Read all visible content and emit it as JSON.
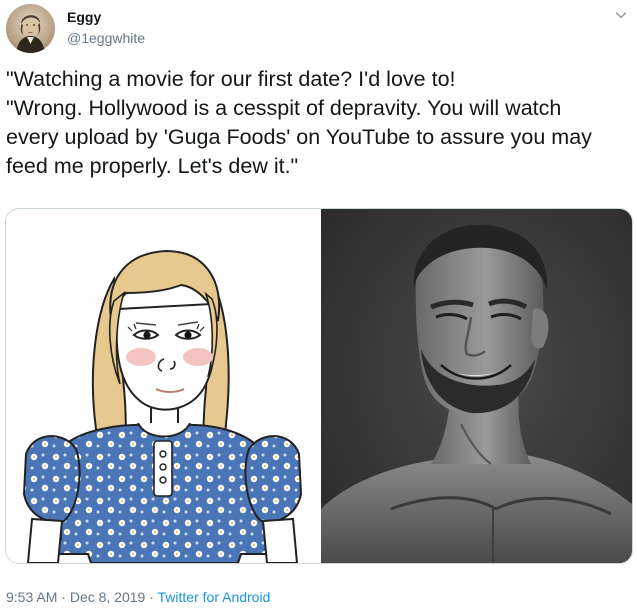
{
  "author": {
    "display_name": "Eggy",
    "handle": "@1eggwhite"
  },
  "tweet": {
    "lines": [
      "\"Watching a movie for our first date? I'd love to!",
      "\"Wrong. Hollywood is a cesspit of depravity. You will watch",
      "every upload by 'Guga Foods' on YouTube to assure you may",
      "feed me properly. Let's dew it.\""
    ]
  },
  "footer": {
    "time": "9:53 AM",
    "sep1": " · ",
    "date": "Dec 8, 2019",
    "sep2": " · ",
    "source": "Twitter for Android"
  },
  "icons": {
    "menu": "chevron-down-icon"
  },
  "colors": {
    "secondary_text": "#657786",
    "link": "#1b95e0",
    "border": "#ccd6dd"
  }
}
